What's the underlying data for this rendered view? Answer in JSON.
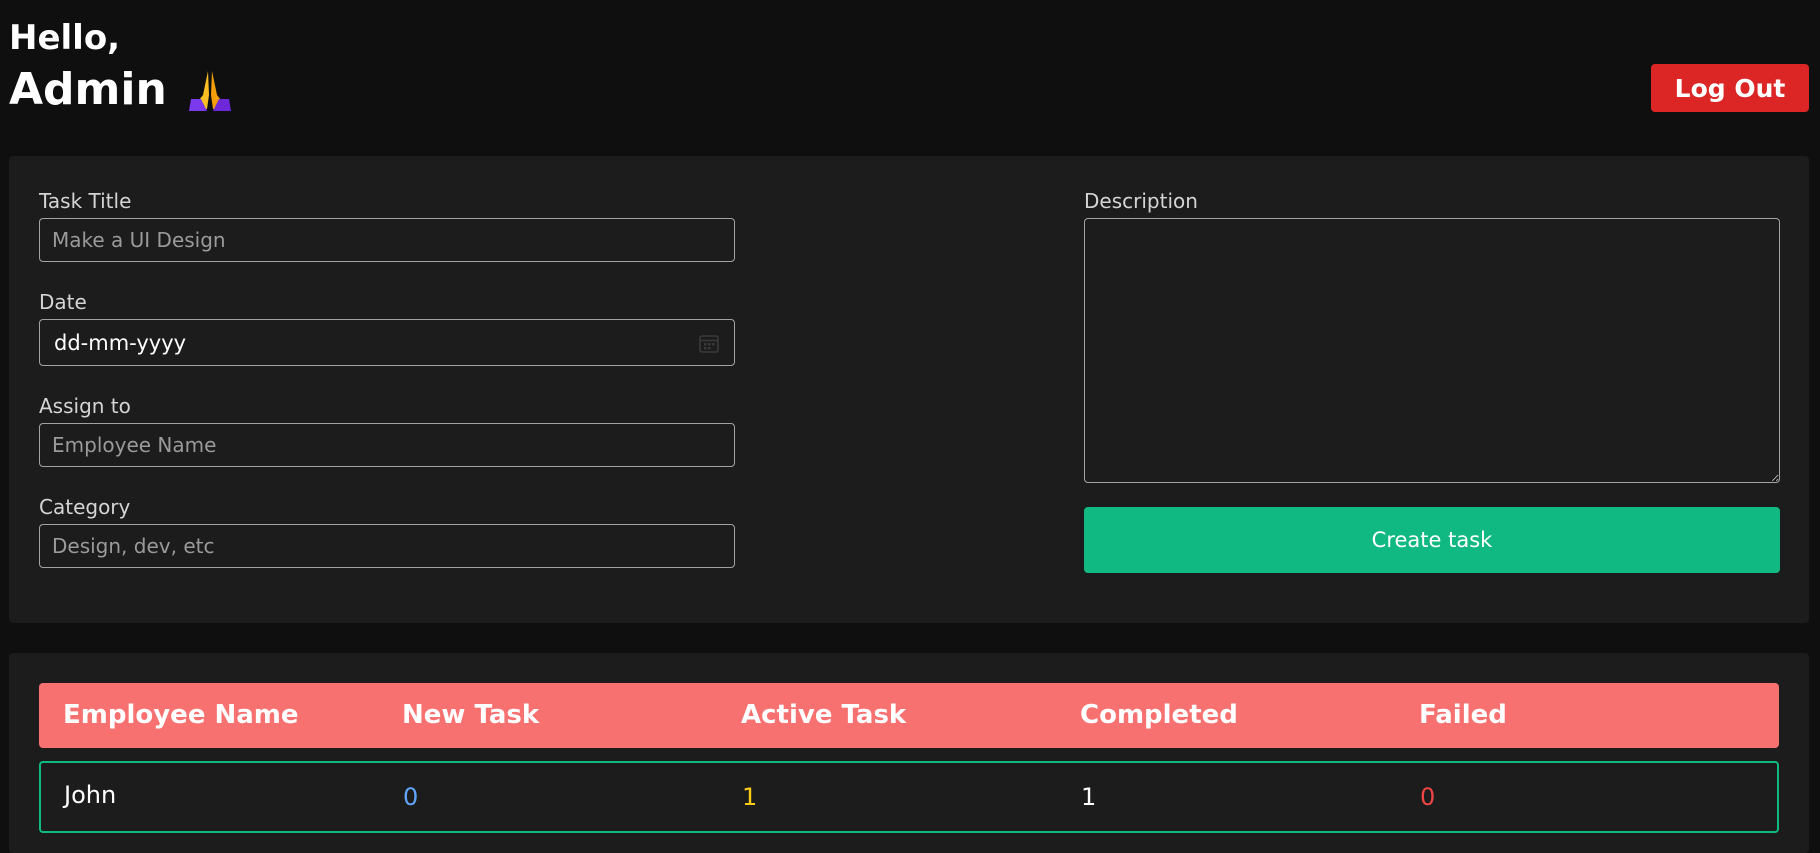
{
  "header": {
    "greeting": "Hello,",
    "user_name": "Admin",
    "emoji": "🙏",
    "logout_label": "Log Out"
  },
  "form": {
    "title_label": "Task Title",
    "title_placeholder": "Make a UI Design",
    "date_label": "Date",
    "date_value": "dd-mm-yyyy",
    "assign_label": "Assign to",
    "assign_placeholder": "Employee Name",
    "category_label": "Category",
    "category_placeholder": "Design, dev, etc",
    "description_label": "Description",
    "create_label": "Create task"
  },
  "table": {
    "headers": [
      "Employee Name",
      "New Task",
      "Active Task",
      "Completed",
      "Failed"
    ],
    "rows": [
      {
        "name": "John",
        "new_task": "0",
        "active_task": "1",
        "completed": "1",
        "failed": "0"
      }
    ]
  },
  "colors": {
    "background": "#0f0f0f",
    "panel": "#1c1c1c",
    "logout": "#dc2626",
    "create": "#10b981",
    "table_header": "#f87171",
    "new_task": "#60a5fa",
    "active_task": "#facc15",
    "completed": "#ffffff",
    "failed": "#ef4444"
  }
}
